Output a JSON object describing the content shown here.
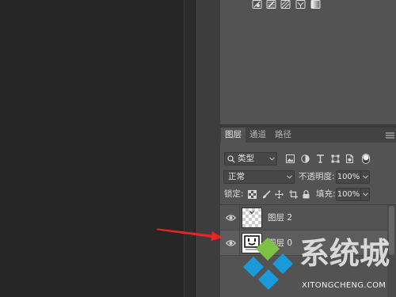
{
  "colors": {
    "canvas_bg": "#262626",
    "panel_bg": "#535353",
    "tab_bar_bg": "#424242",
    "selected_layer_bg": "#5d5d5d",
    "annotation_arrow": "#e52528",
    "watermark_green": "#7dc242",
    "watermark_blue": "#1a9ad8"
  },
  "adjustments_panel": {
    "icons": [
      "invert-icon",
      "posterize-icon",
      "threshold-icon",
      "selective-color-icon",
      "gradient-map-icon"
    ]
  },
  "layers_panel": {
    "tabs": [
      {
        "label": "图层",
        "active": true
      },
      {
        "label": "通道",
        "active": false
      },
      {
        "label": "路径",
        "active": false
      }
    ],
    "menu_icon": "panel-menu-icon",
    "filter": {
      "kind_label": "类型",
      "icons": [
        "pixel-layer-filter-icon",
        "adjustment-layer-filter-icon",
        "type-layer-filter-icon",
        "shape-layer-filter-icon",
        "smart-object-filter-icon"
      ],
      "toggle_on": true
    },
    "blend_mode": "正常",
    "opacity": {
      "label": "不透明度:",
      "value": "100%"
    },
    "lock": {
      "label": "锁定:",
      "icons": [
        "lock-transparent-pixels-icon",
        "lock-image-pixels-icon",
        "lock-position-icon",
        "lock-artboard-icon",
        "lock-all-icon"
      ]
    },
    "fill": {
      "label": "填充:",
      "value": "100%"
    },
    "layers": [
      {
        "name": "图层 2",
        "visible": true,
        "selected": false
      },
      {
        "name": "图层 0",
        "visible": true,
        "selected": true
      }
    ]
  },
  "watermark": {
    "brand": "系统城",
    "domain": "XITONGCHENG.COM"
  }
}
